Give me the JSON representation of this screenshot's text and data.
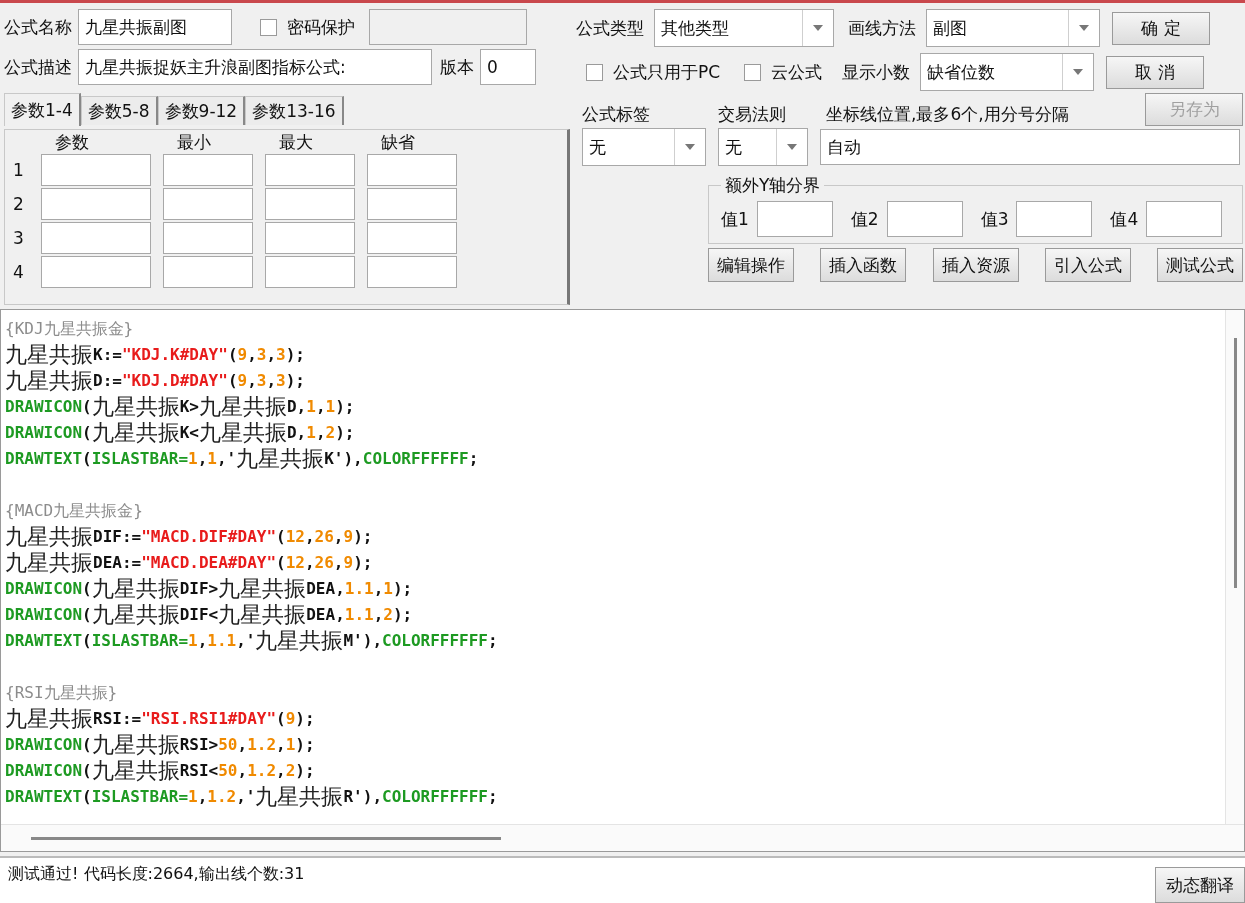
{
  "name": {
    "label": "公式名称",
    "value": "九星共振副图"
  },
  "password_protect": {
    "label": "密码保护",
    "checked": false
  },
  "description": {
    "label": "公式描述",
    "value": "九星共振捉妖主升浪副图指标公式:"
  },
  "version": {
    "label": "版本",
    "value": "0"
  },
  "param_tabs": [
    {
      "label": "参数1-4",
      "selected": true
    },
    {
      "label": "参数5-8",
      "selected": false
    },
    {
      "label": "参数9-12",
      "selected": false
    },
    {
      "label": "参数13-16",
      "selected": false
    }
  ],
  "param_table": {
    "columns": [
      "参数",
      "最小",
      "最大",
      "缺省"
    ],
    "rows": [
      "1",
      "2",
      "3",
      "4"
    ]
  },
  "formula_type": {
    "label": "公式类型",
    "value": "其他类型"
  },
  "draw_method": {
    "label": "画线方法",
    "value": "副图"
  },
  "pc_only": {
    "label": "公式只用于PC",
    "checked": false
  },
  "cloud": {
    "label": "云公式",
    "checked": false
  },
  "decimals": {
    "label": "显示小数",
    "value": "缺省位数"
  },
  "buttons": [
    {
      "label": "确 定",
      "disabled": false
    },
    {
      "label": "取 消",
      "disabled": false
    },
    {
      "label": "另存为",
      "disabled": true
    }
  ],
  "tag": {
    "label": "公式标签",
    "value": "无"
  },
  "trade_rule": {
    "label": "交易法则",
    "value": "无"
  },
  "axis_lines": {
    "label": "坐标线位置,最多6个,用分号分隔",
    "value": "自动"
  },
  "y_bounds": {
    "title": "额外Y轴分界",
    "fields": [
      "值1",
      "值2",
      "值3",
      "值4"
    ]
  },
  "tool_buttons": [
    "编辑操作",
    "插入函数",
    "插入资源",
    "引入公式",
    "测试公式"
  ],
  "code_blocks": [
    {
      "lines": [
        [
          {
            "kind": "comment",
            "text": "{KDJ九星共振金}"
          }
        ],
        [
          {
            "kind": "cjk",
            "text": "九星共振"
          },
          {
            "kind": "text",
            "text": "K:="
          },
          {
            "kind": "string",
            "text": "\"KDJ.K#DAY\""
          },
          {
            "kind": "text",
            "text": "("
          },
          {
            "kind": "number",
            "text": "9"
          },
          {
            "kind": "text",
            "text": ","
          },
          {
            "kind": "number",
            "text": "3"
          },
          {
            "kind": "text",
            "text": ","
          },
          {
            "kind": "number",
            "text": "3"
          },
          {
            "kind": "text",
            "text": ");"
          }
        ],
        [
          {
            "kind": "cjk",
            "text": "九星共振"
          },
          {
            "kind": "text",
            "text": "D:="
          },
          {
            "kind": "string",
            "text": "\"KDJ.D#DAY\""
          },
          {
            "kind": "text",
            "text": "("
          },
          {
            "kind": "number",
            "text": "9"
          },
          {
            "kind": "text",
            "text": ","
          },
          {
            "kind": "number",
            "text": "3"
          },
          {
            "kind": "text",
            "text": ","
          },
          {
            "kind": "number",
            "text": "3"
          },
          {
            "kind": "text",
            "text": ");"
          }
        ],
        [
          {
            "kind": "keyword",
            "text": "DRAWICON"
          },
          {
            "kind": "text",
            "text": "("
          },
          {
            "kind": "cjk",
            "text": "九星共振"
          },
          {
            "kind": "text",
            "text": "K>"
          },
          {
            "kind": "cjk",
            "text": "九星共振"
          },
          {
            "kind": "text",
            "text": "D,"
          },
          {
            "kind": "number",
            "text": "1"
          },
          {
            "kind": "text",
            "text": ","
          },
          {
            "kind": "number",
            "text": "1"
          },
          {
            "kind": "text",
            "text": ");"
          }
        ],
        [
          {
            "kind": "keyword",
            "text": "DRAWICON"
          },
          {
            "kind": "text",
            "text": "("
          },
          {
            "kind": "cjk",
            "text": "九星共振"
          },
          {
            "kind": "text",
            "text": "K<"
          },
          {
            "kind": "cjk",
            "text": "九星共振"
          },
          {
            "kind": "text",
            "text": "D,"
          },
          {
            "kind": "number",
            "text": "1"
          },
          {
            "kind": "text",
            "text": ","
          },
          {
            "kind": "number",
            "text": "2"
          },
          {
            "kind": "text",
            "text": ");"
          }
        ],
        [
          {
            "kind": "keyword",
            "text": "DRAWTEXT"
          },
          {
            "kind": "text",
            "text": "("
          },
          {
            "kind": "keyword",
            "text": "ISLASTBAR="
          },
          {
            "kind": "number",
            "text": "1"
          },
          {
            "kind": "text",
            "text": ","
          },
          {
            "kind": "number",
            "text": "1"
          },
          {
            "kind": "text",
            "text": ",'"
          },
          {
            "kind": "cjk",
            "text": "九星共振"
          },
          {
            "kind": "text",
            "text": "K'),"
          },
          {
            "kind": "keyword",
            "text": "COLORFFFFFF"
          },
          {
            "kind": "text",
            "text": ";"
          }
        ]
      ]
    },
    {
      "lines": [
        [
          {
            "kind": "comment",
            "text": "{MACD九星共振金}"
          }
        ],
        [
          {
            "kind": "cjk",
            "text": "九星共振"
          },
          {
            "kind": "text",
            "text": "DIF:="
          },
          {
            "kind": "string",
            "text": "\"MACD.DIF#DAY\""
          },
          {
            "kind": "text",
            "text": "("
          },
          {
            "kind": "number",
            "text": "12"
          },
          {
            "kind": "text",
            "text": ","
          },
          {
            "kind": "number",
            "text": "26"
          },
          {
            "kind": "text",
            "text": ","
          },
          {
            "kind": "number",
            "text": "9"
          },
          {
            "kind": "text",
            "text": ");"
          }
        ],
        [
          {
            "kind": "cjk",
            "text": "九星共振"
          },
          {
            "kind": "text",
            "text": "DEA:="
          },
          {
            "kind": "string",
            "text": "\"MACD.DEA#DAY\""
          },
          {
            "kind": "text",
            "text": "("
          },
          {
            "kind": "number",
            "text": "12"
          },
          {
            "kind": "text",
            "text": ","
          },
          {
            "kind": "number",
            "text": "26"
          },
          {
            "kind": "text",
            "text": ","
          },
          {
            "kind": "number",
            "text": "9"
          },
          {
            "kind": "text",
            "text": ");"
          }
        ],
        [
          {
            "kind": "keyword",
            "text": "DRAWICON"
          },
          {
            "kind": "text",
            "text": "("
          },
          {
            "kind": "cjk",
            "text": "九星共振"
          },
          {
            "kind": "text",
            "text": "DIF>"
          },
          {
            "kind": "cjk",
            "text": "九星共振"
          },
          {
            "kind": "text",
            "text": "DEA,"
          },
          {
            "kind": "number",
            "text": "1.1"
          },
          {
            "kind": "text",
            "text": ","
          },
          {
            "kind": "number",
            "text": "1"
          },
          {
            "kind": "text",
            "text": ");"
          }
        ],
        [
          {
            "kind": "keyword",
            "text": "DRAWICON"
          },
          {
            "kind": "text",
            "text": "("
          },
          {
            "kind": "cjk",
            "text": "九星共振"
          },
          {
            "kind": "text",
            "text": "DIF<"
          },
          {
            "kind": "cjk",
            "text": "九星共振"
          },
          {
            "kind": "text",
            "text": "DEA,"
          },
          {
            "kind": "number",
            "text": "1.1"
          },
          {
            "kind": "text",
            "text": ","
          },
          {
            "kind": "number",
            "text": "2"
          },
          {
            "kind": "text",
            "text": ");"
          }
        ],
        [
          {
            "kind": "keyword",
            "text": "DRAWTEXT"
          },
          {
            "kind": "text",
            "text": "("
          },
          {
            "kind": "keyword",
            "text": "ISLASTBAR="
          },
          {
            "kind": "number",
            "text": "1"
          },
          {
            "kind": "text",
            "text": ","
          },
          {
            "kind": "number",
            "text": "1.1"
          },
          {
            "kind": "text",
            "text": ",'"
          },
          {
            "kind": "cjk",
            "text": "九星共振"
          },
          {
            "kind": "text",
            "text": "M'),"
          },
          {
            "kind": "keyword",
            "text": "COLORFFFFFF"
          },
          {
            "kind": "text",
            "text": ";"
          }
        ]
      ]
    },
    {
      "lines": [
        [
          {
            "kind": "comment",
            "text": "{RSI九星共振}"
          }
        ],
        [
          {
            "kind": "cjk",
            "text": "九星共振"
          },
          {
            "kind": "text",
            "text": "RSI:="
          },
          {
            "kind": "string",
            "text": "\"RSI.RSI1#DAY\""
          },
          {
            "kind": "text",
            "text": "("
          },
          {
            "kind": "number",
            "text": "9"
          },
          {
            "kind": "text",
            "text": ");"
          }
        ],
        [
          {
            "kind": "keyword",
            "text": "DRAWICON"
          },
          {
            "kind": "text",
            "text": "("
          },
          {
            "kind": "cjk",
            "text": "九星共振"
          },
          {
            "kind": "text",
            "text": "RSI>"
          },
          {
            "kind": "number",
            "text": "50"
          },
          {
            "kind": "text",
            "text": ","
          },
          {
            "kind": "number",
            "text": "1.2"
          },
          {
            "kind": "text",
            "text": ","
          },
          {
            "kind": "number",
            "text": "1"
          },
          {
            "kind": "text",
            "text": ");"
          }
        ],
        [
          {
            "kind": "keyword",
            "text": "DRAWICON"
          },
          {
            "kind": "text",
            "text": "("
          },
          {
            "kind": "cjk",
            "text": "九星共振"
          },
          {
            "kind": "text",
            "text": "RSI<"
          },
          {
            "kind": "number",
            "text": "50"
          },
          {
            "kind": "text",
            "text": ","
          },
          {
            "kind": "number",
            "text": "1.2"
          },
          {
            "kind": "text",
            "text": ","
          },
          {
            "kind": "number",
            "text": "2"
          },
          {
            "kind": "text",
            "text": ");"
          }
        ],
        [
          {
            "kind": "keyword",
            "text": "DRAWTEXT"
          },
          {
            "kind": "text",
            "text": "("
          },
          {
            "kind": "keyword",
            "text": "ISLASTBAR="
          },
          {
            "kind": "number",
            "text": "1"
          },
          {
            "kind": "text",
            "text": ","
          },
          {
            "kind": "number",
            "text": "1.2"
          },
          {
            "kind": "text",
            "text": ",'"
          },
          {
            "kind": "cjk",
            "text": "九星共振"
          },
          {
            "kind": "text",
            "text": "R'),"
          },
          {
            "kind": "keyword",
            "text": "COLORFFFFFF"
          },
          {
            "kind": "text",
            "text": ";"
          }
        ]
      ]
    }
  ],
  "status": {
    "message": "测试通过! 代码长度:2664,输出线个数:31",
    "button": "动态翻译"
  }
}
